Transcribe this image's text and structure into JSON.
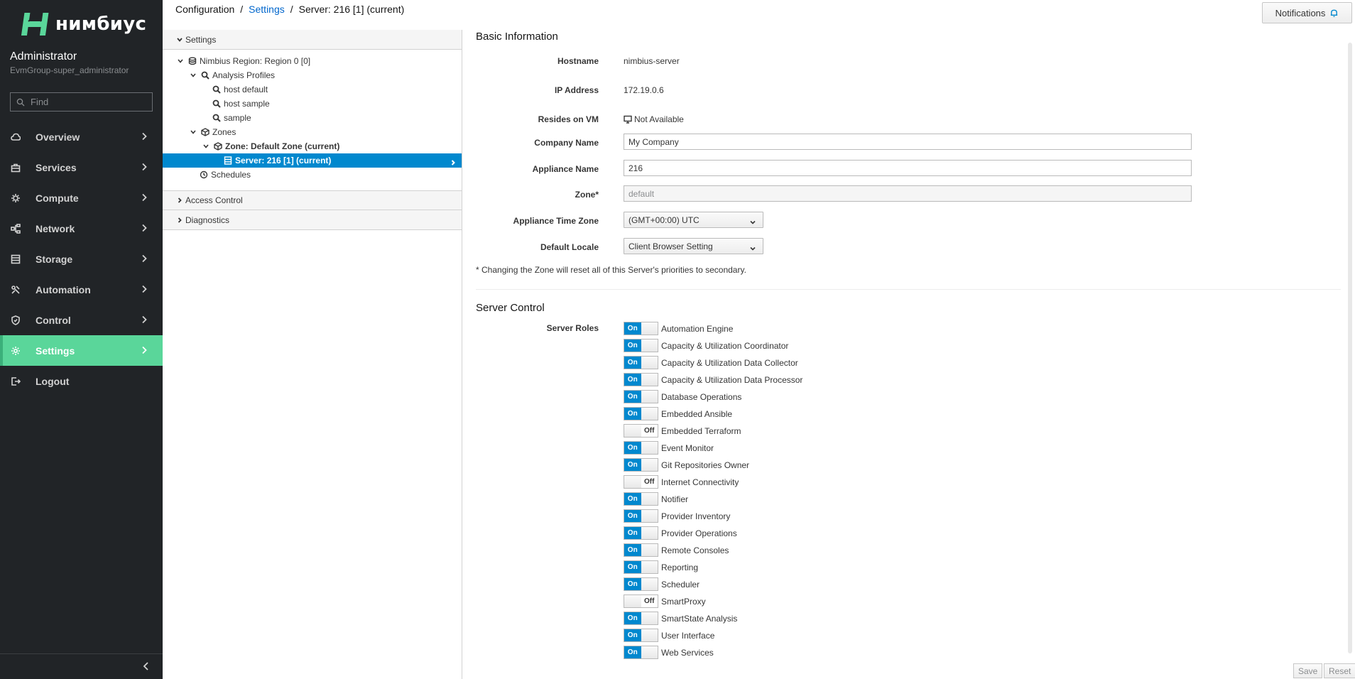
{
  "brand": {
    "name": "нимбиус",
    "color": "#5ad69a"
  },
  "user": {
    "name": "Administrator",
    "group": "EvmGroup-super_administrator"
  },
  "nav": {
    "find_placeholder": "Find",
    "items": [
      {
        "label": "Overview",
        "icon": "cloud-icon"
      },
      {
        "label": "Services",
        "icon": "briefcase-icon"
      },
      {
        "label": "Compute",
        "icon": "cpu-icon"
      },
      {
        "label": "Network",
        "icon": "network-icon"
      },
      {
        "label": "Storage",
        "icon": "database-icon"
      },
      {
        "label": "Automation",
        "icon": "automation-icon"
      },
      {
        "label": "Control",
        "icon": "shield-icon"
      },
      {
        "label": "Settings",
        "icon": "gear-icon",
        "active": true
      },
      {
        "label": "Logout",
        "icon": "logout-icon"
      }
    ]
  },
  "breadcrumb": {
    "root": "Configuration",
    "section": "Settings",
    "current": "Server: 216 [1] (current)"
  },
  "header": {
    "notifications_label": "Notifications"
  },
  "tree": {
    "settings_heading": "Settings",
    "access_control_heading": "Access Control",
    "diagnostics_heading": "Diagnostics",
    "nodes": {
      "region": "Nimbius Region: Region 0 [0]",
      "analysis_profiles": "Analysis Profiles",
      "host_default": "host default",
      "host_sample": "host sample",
      "sample": "sample",
      "zones": "Zones",
      "zone_default": "Zone: Default Zone (current)",
      "server": "Server: 216 [1] (current)",
      "schedules": "Schedules"
    }
  },
  "basic_info": {
    "title": "Basic Information",
    "hostname_label": "Hostname",
    "hostname": "nimbius-server",
    "ip_label": "IP Address",
    "ip": "172.19.0.6",
    "resides_label": "Resides on VM",
    "resides": "Not Available",
    "company_label": "Company Name",
    "company": "My Company",
    "appliance_label": "Appliance Name",
    "appliance": "216",
    "zone_label": "Zone*",
    "zone": "default",
    "timezone_label": "Appliance Time Zone",
    "timezone": "(GMT+00:00) UTC",
    "locale_label": "Default Locale",
    "locale": "Client Browser Setting",
    "zone_note": "* Changing the Zone will reset all of this Server's priorities to secondary."
  },
  "server_control": {
    "title": "Server Control",
    "roles_label": "Server Roles",
    "on_text": "On",
    "off_text": "Off",
    "roles": [
      {
        "name": "Automation Engine",
        "on": true
      },
      {
        "name": "Capacity & Utilization Coordinator",
        "on": true
      },
      {
        "name": "Capacity & Utilization Data Collector",
        "on": true
      },
      {
        "name": "Capacity & Utilization Data Processor",
        "on": true
      },
      {
        "name": "Database Operations",
        "on": true
      },
      {
        "name": "Embedded Ansible",
        "on": true
      },
      {
        "name": "Embedded Terraform",
        "on": false
      },
      {
        "name": "Event Monitor",
        "on": true
      },
      {
        "name": "Git Repositories Owner",
        "on": true
      },
      {
        "name": "Internet Connectivity",
        "on": false
      },
      {
        "name": "Notifier",
        "on": true
      },
      {
        "name": "Provider Inventory",
        "on": true
      },
      {
        "name": "Provider Operations",
        "on": true
      },
      {
        "name": "Remote Consoles",
        "on": true
      },
      {
        "name": "Reporting",
        "on": true
      },
      {
        "name": "Scheduler",
        "on": true
      },
      {
        "name": "SmartProxy",
        "on": false
      },
      {
        "name": "SmartState Analysis",
        "on": true
      },
      {
        "name": "User Interface",
        "on": true
      },
      {
        "name": "Web Services",
        "on": true
      }
    ]
  },
  "footer": {
    "save_label": "Save",
    "reset_label": "Reset"
  }
}
